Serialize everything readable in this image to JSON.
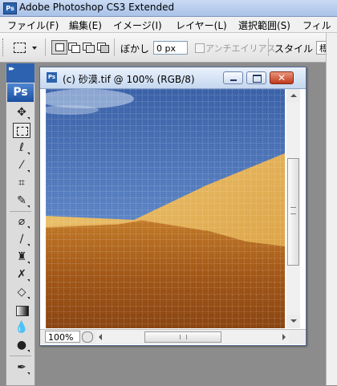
{
  "app": {
    "title": "Adobe Photoshop CS3 Extended",
    "icon": "photoshop-app-icon"
  },
  "menubar": {
    "items": [
      "ファイル(F)",
      "編集(E)",
      "イメージ(I)",
      "レイヤー(L)",
      "選択範囲(S)",
      "フィル"
    ]
  },
  "options": {
    "blur_label": "ぼかし :",
    "blur_value": "0 px",
    "antialias_label": "アンチエイリアス",
    "style_label": "スタイル :",
    "style_value": "標準"
  },
  "toolbox": {
    "logo": "Ps",
    "tools": [
      "move-tool",
      "rectangular-marquee-tool",
      "lasso-tool",
      "magic-wand-tool",
      "crop-tool",
      "slice-tool",
      "healing-brush-tool",
      "brush-tool",
      "clone-stamp-tool",
      "history-brush-tool",
      "eraser-tool",
      "gradient-tool",
      "blur-tool",
      "dodge-tool",
      "pen-tool"
    ]
  },
  "document": {
    "title": "(c) 砂漠.tif @ 100% (RGB/8)",
    "zoom": "100%",
    "grid_visible": true
  },
  "colors": {
    "sky_top": "#3b62a8",
    "sky_bottom": "#8db0dc",
    "sand_light": "#e5b459",
    "sand_dark": "#9c4f14"
  }
}
